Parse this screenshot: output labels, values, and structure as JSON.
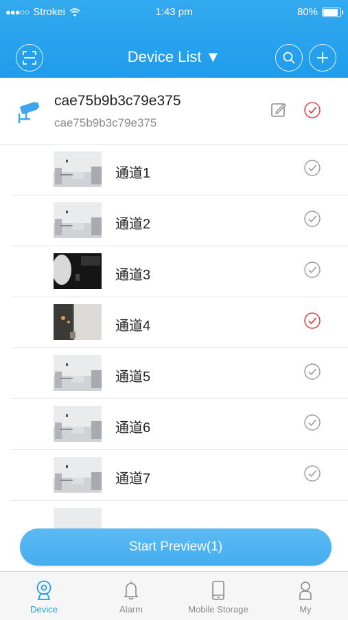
{
  "status_bar": {
    "carrier": "Strokei",
    "time": "1:43 pm",
    "battery": "80%"
  },
  "header": {
    "title": "Device List ▼"
  },
  "device": {
    "name": "cae75b9b3c79e375",
    "serial": "cae75b9b3c79e375",
    "selected": true
  },
  "channels": [
    {
      "label": "通道1",
      "selected": false,
      "thumb": "room-light"
    },
    {
      "label": "通道2",
      "selected": false,
      "thumb": "room-light"
    },
    {
      "label": "通道3",
      "selected": false,
      "thumb": "dark"
    },
    {
      "label": "通道4",
      "selected": true,
      "thumb": "door"
    },
    {
      "label": "通道5",
      "selected": false,
      "thumb": "room-light"
    },
    {
      "label": "通道6",
      "selected": false,
      "thumb": "room-light"
    },
    {
      "label": "通道7",
      "selected": false,
      "thumb": "room-light"
    }
  ],
  "preview_button": {
    "label": "Start Preview(1)"
  },
  "tabs": [
    {
      "label": "Device",
      "icon": "device-icon",
      "active": true
    },
    {
      "label": "Alarm",
      "icon": "bell-icon",
      "active": false
    },
    {
      "label": "Mobile Storage",
      "icon": "phone-icon",
      "active": false
    },
    {
      "label": "My",
      "icon": "person-icon",
      "active": false
    }
  ],
  "colors": {
    "accent": "#1e9cec",
    "selected_check": "#e0464c",
    "unselected_check": "#9a9a9a"
  }
}
